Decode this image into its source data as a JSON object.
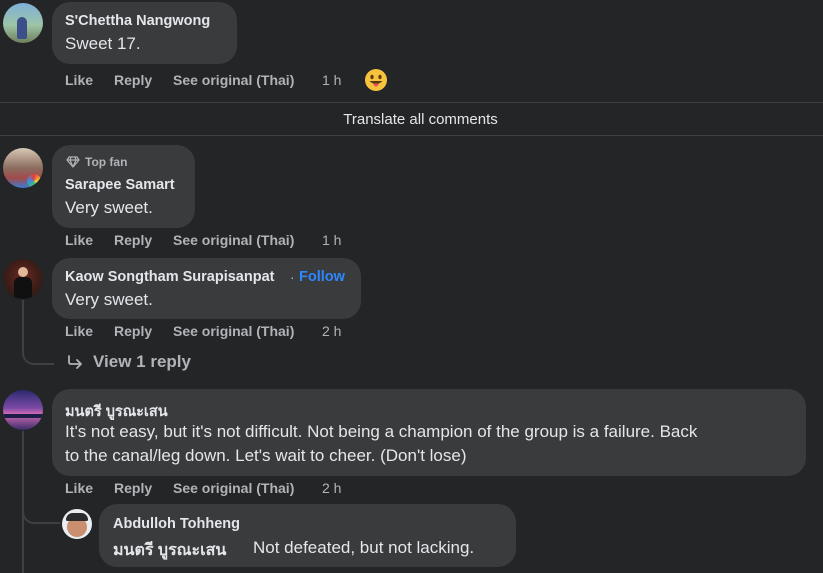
{
  "comments": [
    {
      "author": "S'Chettha Nangwong",
      "text": "Sweet 17.",
      "actions": {
        "like": "Like",
        "reply": "Reply",
        "see_original": "See original (Thai)",
        "time": "1 h"
      },
      "reaction_icon": "grinning-tongue-emoji"
    },
    {
      "badge": "Top fan",
      "badge_icon": "diamond-icon",
      "author": "Sarapee Samart",
      "text": "Very sweet.",
      "actions": {
        "like": "Like",
        "reply": "Reply",
        "see_original": "See original (Thai)",
        "time": "1 h"
      }
    },
    {
      "author": "Kaow Songtham Surapisanpat",
      "separator": "·",
      "follow": "Follow",
      "text": "Very sweet.",
      "actions": {
        "like": "Like",
        "reply": "Reply",
        "see_original": "See original (Thai)",
        "time": "2 h"
      },
      "view_replies": "View 1 reply",
      "view_replies_icon": "reply-arrow-icon"
    },
    {
      "author": "มนตรี บูรณะเสน",
      "text_line1": "It's not easy, but it's not difficult. Not being a champion of the group is a failure. Back",
      "text_line2": "to the canal/leg down. Let's wait to cheer. (Don't lose)",
      "actions": {
        "like": "Like",
        "reply": "Reply",
        "see_original": "See original (Thai)",
        "time": "2 h"
      }
    }
  ],
  "reply": {
    "author": "Abdulloh Tohheng",
    "mention": "มนตรี บูรณะเสน",
    "text": "Not defeated, but not lacking."
  },
  "translate_all": "Translate all comments",
  "colors": {
    "background": "#242526",
    "bubble": "#3a3b3c",
    "text": "#e4e6eb",
    "secondary": "#b0b3b8",
    "link": "#2d88ff"
  }
}
